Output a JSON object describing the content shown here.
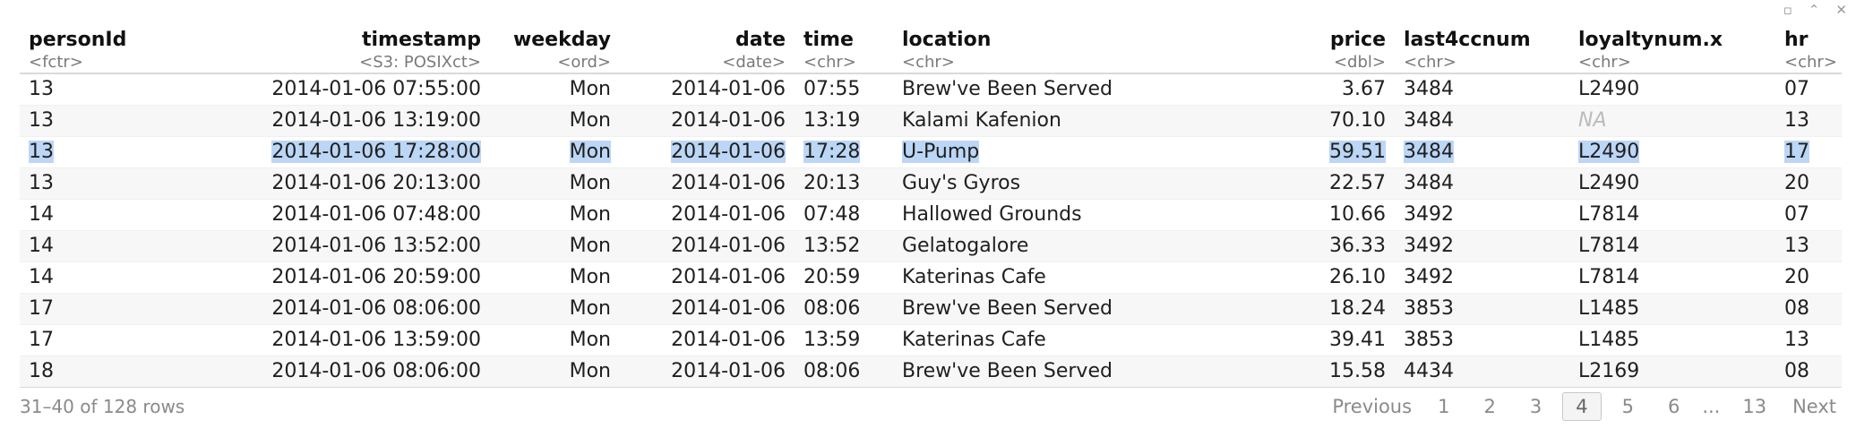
{
  "columns": [
    {
      "name": "personId",
      "type": "<fctr>"
    },
    {
      "name": "timestamp",
      "type": "<S3: POSIXct>"
    },
    {
      "name": "weekday",
      "type": "<ord>"
    },
    {
      "name": "date",
      "type": "<date>"
    },
    {
      "name": "time",
      "type": "<chr>"
    },
    {
      "name": "location",
      "type": "<chr>"
    },
    {
      "name": "price",
      "type": "<dbl>"
    },
    {
      "name": "last4ccnum",
      "type": "<chr>"
    },
    {
      "name": "loyaltynum.x",
      "type": "<chr>"
    },
    {
      "name": "hr",
      "type": "<chr>"
    }
  ],
  "rows": [
    [
      "13",
      "2014-01-06 07:55:00",
      "Mon",
      "2014-01-06",
      "07:55",
      "Brew've Been Served",
      "3.67",
      "3484",
      "L2490",
      "07"
    ],
    [
      "13",
      "2014-01-06 13:19:00",
      "Mon",
      "2014-01-06",
      "13:19",
      "Kalami Kafenion",
      "70.10",
      "3484",
      "NA",
      "13"
    ],
    [
      "13",
      "2014-01-06 17:28:00",
      "Mon",
      "2014-01-06",
      "17:28",
      "U-Pump",
      "59.51",
      "3484",
      "L2490",
      "17"
    ],
    [
      "13",
      "2014-01-06 20:13:00",
      "Mon",
      "2014-01-06",
      "20:13",
      "Guy's Gyros",
      "22.57",
      "3484",
      "L2490",
      "20"
    ],
    [
      "14",
      "2014-01-06 07:48:00",
      "Mon",
      "2014-01-06",
      "07:48",
      "Hallowed Grounds",
      "10.66",
      "3492",
      "L7814",
      "07"
    ],
    [
      "14",
      "2014-01-06 13:52:00",
      "Mon",
      "2014-01-06",
      "13:52",
      "Gelatogalore",
      "36.33",
      "3492",
      "L7814",
      "13"
    ],
    [
      "14",
      "2014-01-06 20:59:00",
      "Mon",
      "2014-01-06",
      "20:59",
      "Katerinas Cafe",
      "26.10",
      "3492",
      "L7814",
      "20"
    ],
    [
      "17",
      "2014-01-06 08:06:00",
      "Mon",
      "2014-01-06",
      "08:06",
      "Brew've Been Served",
      "18.24",
      "3853",
      "L1485",
      "08"
    ],
    [
      "17",
      "2014-01-06 13:59:00",
      "Mon",
      "2014-01-06",
      "13:59",
      "Katerinas Cafe",
      "39.41",
      "3853",
      "L1485",
      "13"
    ],
    [
      "18",
      "2014-01-06 08:06:00",
      "Mon",
      "2014-01-06",
      "08:06",
      "Brew've Been Served",
      "15.58",
      "4434",
      "L2169",
      "08"
    ]
  ],
  "footer": {
    "info": "31–40 of 128 rows",
    "previous": "Previous",
    "next": "Next",
    "pages": [
      "1",
      "2",
      "3",
      "4",
      "5",
      "6"
    ],
    "ellipsis": "...",
    "last_page": "13",
    "current_page": "4"
  },
  "top_icons": [
    "expand-icon",
    "collapse-icon",
    "close-icon"
  ],
  "colors": {
    "selection": "#bcd6f5",
    "stripe": "#f7f7f7",
    "muted": "#8a8a8a"
  }
}
